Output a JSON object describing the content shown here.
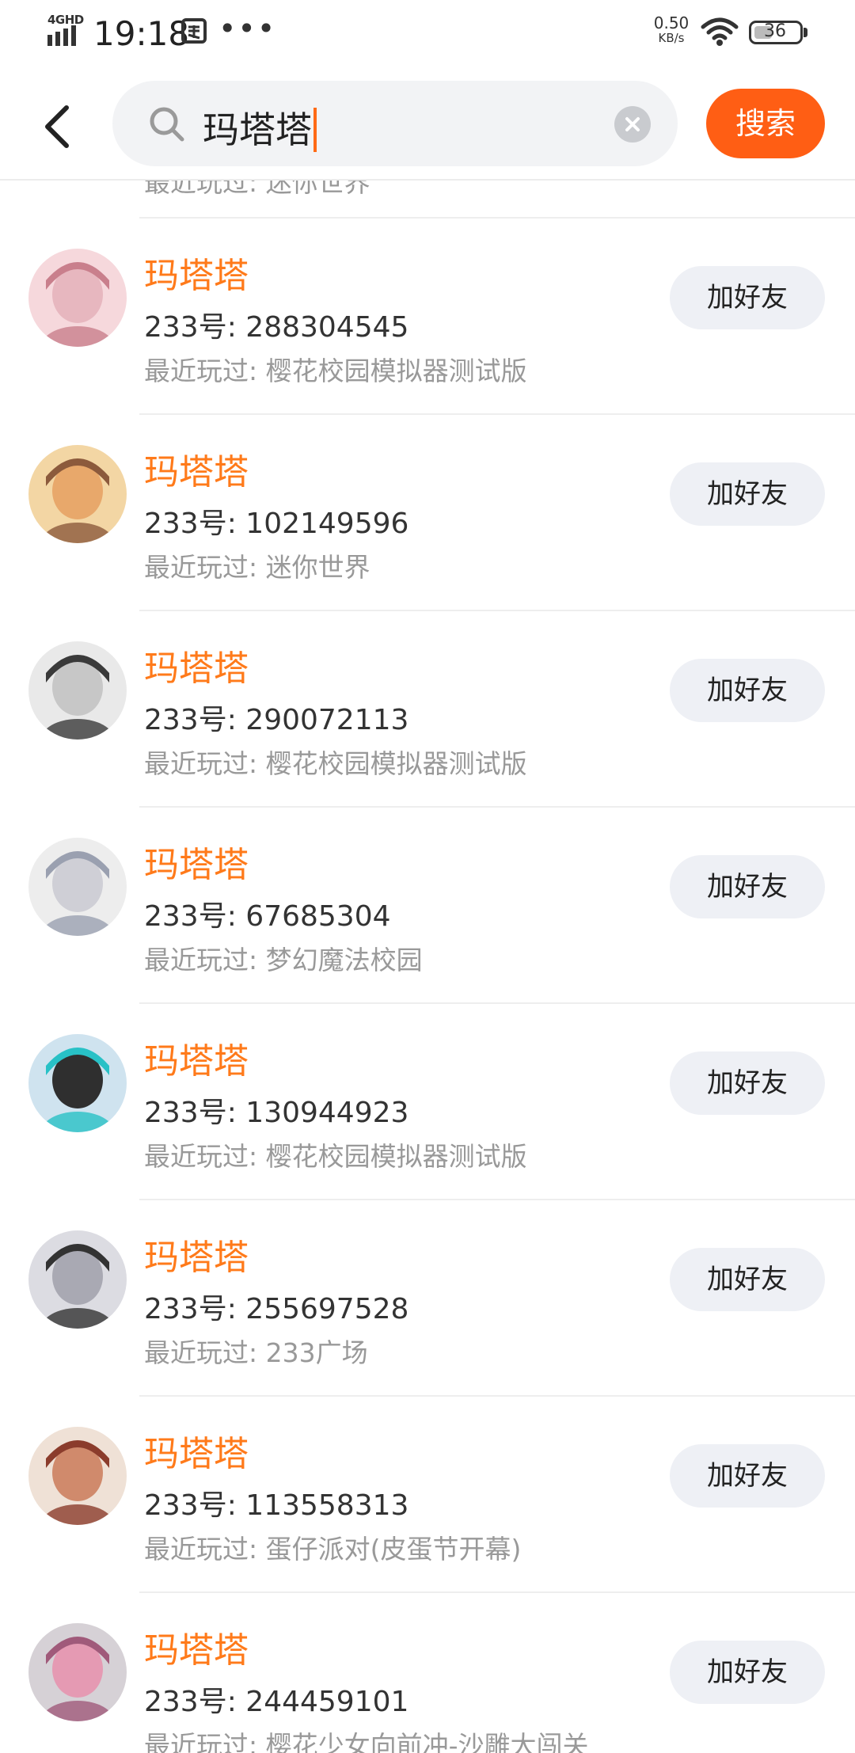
{
  "status_bar": {
    "network": "4GHD",
    "time": "19:18",
    "speed_value": "0.50",
    "speed_unit": "KB/s",
    "battery": "36"
  },
  "search": {
    "query": "玛塔塔",
    "button_label": "搜索"
  },
  "partial_row": {
    "recent": "最近玩过: 迷你世界"
  },
  "results": [
    {
      "name": "玛塔塔",
      "id": "233号: 288304545",
      "recent": "最近玩过: 樱花校园模拟器测试版",
      "button": "加好友",
      "avatar_colors": [
        "#f6d8dc",
        "#e7b7bf",
        "#c97f8c"
      ]
    },
    {
      "name": "玛塔塔",
      "id": "233号: 102149596",
      "recent": "最近玩过: 迷你世界",
      "button": "加好友",
      "avatar_colors": [
        "#f3d6a4",
        "#e8a86b",
        "#8c5a3c"
      ]
    },
    {
      "name": "玛塔塔",
      "id": "233号: 290072113",
      "recent": "最近玩过: 樱花校园模拟器测试版",
      "button": "加好友",
      "avatar_colors": [
        "#e9e9e9",
        "#c7c7c7",
        "#3a3a3a"
      ]
    },
    {
      "name": "玛塔塔",
      "id": "233号: 67685304",
      "recent": "最近玩过: 梦幻魔法校园",
      "button": "加好友",
      "avatar_colors": [
        "#ededed",
        "#cfcfd6",
        "#9aa0b0"
      ]
    },
    {
      "name": "玛塔塔",
      "id": "233号: 130944923",
      "recent": "最近玩过: 樱花校园模拟器测试版",
      "button": "加好友",
      "avatar_colors": [
        "#cfe3ef",
        "#2f2f2f",
        "#28c1c6"
      ]
    },
    {
      "name": "玛塔塔",
      "id": "233号: 255697528",
      "recent": "最近玩过: 233广场",
      "button": "加好友",
      "avatar_colors": [
        "#dcdce2",
        "#a9a9b3",
        "#333333"
      ]
    },
    {
      "name": "玛塔塔",
      "id": "233号: 113558313",
      "recent": "最近玩过: 蛋仔派对(皮蛋节开幕)",
      "button": "加好友",
      "avatar_colors": [
        "#efe1d6",
        "#d08a6c",
        "#8b3c2c"
      ]
    },
    {
      "name": "玛塔塔",
      "id": "233号: 244459101",
      "recent": "最近玩过: 樱花少女向前冲-沙雕大闯关",
      "button": "加好友",
      "avatar_colors": [
        "#d6d1d6",
        "#e59ab3",
        "#a05a7a"
      ]
    }
  ],
  "colors": {
    "accent": "#ff5e14",
    "name": "#ff7a1a",
    "button_bg": "#eef0f5"
  }
}
